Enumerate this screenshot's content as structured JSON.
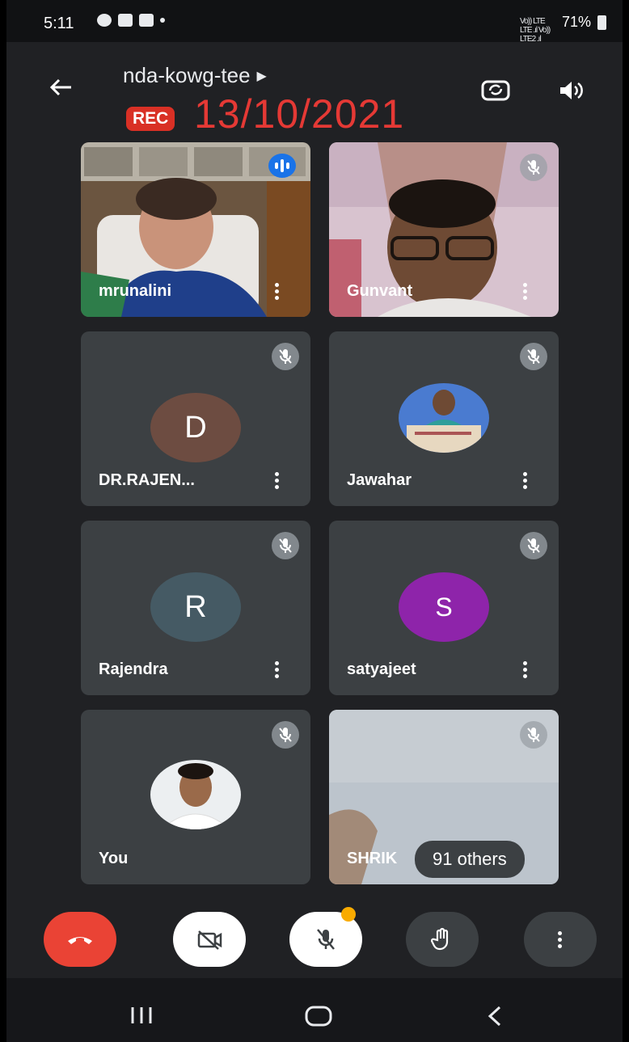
{
  "status_bar": {
    "time": "5:11",
    "network_text": "Vo)) LTE LTE .ıl Vo)) LTE2 .ıl",
    "battery": "71%"
  },
  "header": {
    "meeting_code": "nda-kowg-tee",
    "rec_badge": "REC",
    "date_overlay": "13/10/2021"
  },
  "participants": [
    {
      "name": "mrunalini",
      "kind": "video",
      "speaking": true
    },
    {
      "name": "Gunvant",
      "kind": "video",
      "muted": true
    },
    {
      "name": "DR.RAJEN...",
      "kind": "initial",
      "initial": "D",
      "avatar_color": "#6d4c41",
      "muted": true
    },
    {
      "name": "Jawahar",
      "kind": "photo",
      "muted": true
    },
    {
      "name": "Rajendra",
      "kind": "initial",
      "initial": "R",
      "avatar_color": "#455a64",
      "muted": true
    },
    {
      "name": "satyajeet",
      "kind": "initial",
      "initial": "S",
      "avatar_color": "#8e24aa",
      "muted": true
    },
    {
      "name": "You",
      "kind": "photo",
      "muted": true
    },
    {
      "name": "SHRIK",
      "kind": "video",
      "muted": true,
      "others_label": "91 others"
    }
  ],
  "controls": {
    "end_call": "phone-hangup-icon",
    "camera": "camera-off-icon",
    "mic": "mic-off-icon",
    "raise_hand": "hand-icon",
    "more": "more-vert-icon"
  },
  "colors": {
    "background": "#202124",
    "tile": "#3c4043",
    "end_call": "#ea4335",
    "rec": "#d93025",
    "date": "#e53935",
    "speaking": "#1a73e8"
  }
}
